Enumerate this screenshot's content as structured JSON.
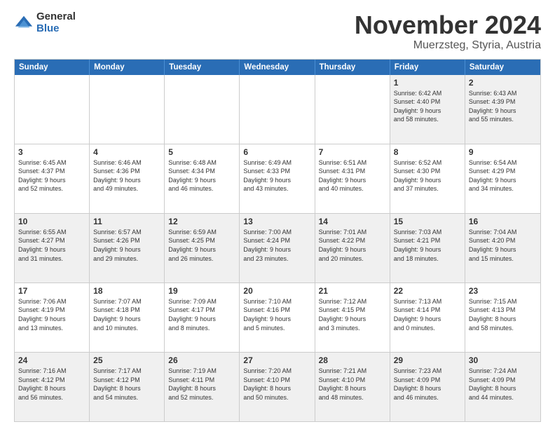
{
  "header": {
    "logo": {
      "general": "General",
      "blue": "Blue"
    },
    "title": "November 2024",
    "location": "Muerzsteg, Styria, Austria"
  },
  "calendar": {
    "days": [
      "Sunday",
      "Monday",
      "Tuesday",
      "Wednesday",
      "Thursday",
      "Friday",
      "Saturday"
    ],
    "weeks": [
      [
        {
          "day": "",
          "content": ""
        },
        {
          "day": "",
          "content": ""
        },
        {
          "day": "",
          "content": ""
        },
        {
          "day": "",
          "content": ""
        },
        {
          "day": "",
          "content": ""
        },
        {
          "day": "1",
          "content": "Sunrise: 6:42 AM\nSunset: 4:40 PM\nDaylight: 9 hours\nand 58 minutes."
        },
        {
          "day": "2",
          "content": "Sunrise: 6:43 AM\nSunset: 4:39 PM\nDaylight: 9 hours\nand 55 minutes."
        }
      ],
      [
        {
          "day": "3",
          "content": "Sunrise: 6:45 AM\nSunset: 4:37 PM\nDaylight: 9 hours\nand 52 minutes."
        },
        {
          "day": "4",
          "content": "Sunrise: 6:46 AM\nSunset: 4:36 PM\nDaylight: 9 hours\nand 49 minutes."
        },
        {
          "day": "5",
          "content": "Sunrise: 6:48 AM\nSunset: 4:34 PM\nDaylight: 9 hours\nand 46 minutes."
        },
        {
          "day": "6",
          "content": "Sunrise: 6:49 AM\nSunset: 4:33 PM\nDaylight: 9 hours\nand 43 minutes."
        },
        {
          "day": "7",
          "content": "Sunrise: 6:51 AM\nSunset: 4:31 PM\nDaylight: 9 hours\nand 40 minutes."
        },
        {
          "day": "8",
          "content": "Sunrise: 6:52 AM\nSunset: 4:30 PM\nDaylight: 9 hours\nand 37 minutes."
        },
        {
          "day": "9",
          "content": "Sunrise: 6:54 AM\nSunset: 4:29 PM\nDaylight: 9 hours\nand 34 minutes."
        }
      ],
      [
        {
          "day": "10",
          "content": "Sunrise: 6:55 AM\nSunset: 4:27 PM\nDaylight: 9 hours\nand 31 minutes."
        },
        {
          "day": "11",
          "content": "Sunrise: 6:57 AM\nSunset: 4:26 PM\nDaylight: 9 hours\nand 29 minutes."
        },
        {
          "day": "12",
          "content": "Sunrise: 6:59 AM\nSunset: 4:25 PM\nDaylight: 9 hours\nand 26 minutes."
        },
        {
          "day": "13",
          "content": "Sunrise: 7:00 AM\nSunset: 4:24 PM\nDaylight: 9 hours\nand 23 minutes."
        },
        {
          "day": "14",
          "content": "Sunrise: 7:01 AM\nSunset: 4:22 PM\nDaylight: 9 hours\nand 20 minutes."
        },
        {
          "day": "15",
          "content": "Sunrise: 7:03 AM\nSunset: 4:21 PM\nDaylight: 9 hours\nand 18 minutes."
        },
        {
          "day": "16",
          "content": "Sunrise: 7:04 AM\nSunset: 4:20 PM\nDaylight: 9 hours\nand 15 minutes."
        }
      ],
      [
        {
          "day": "17",
          "content": "Sunrise: 7:06 AM\nSunset: 4:19 PM\nDaylight: 9 hours\nand 13 minutes."
        },
        {
          "day": "18",
          "content": "Sunrise: 7:07 AM\nSunset: 4:18 PM\nDaylight: 9 hours\nand 10 minutes."
        },
        {
          "day": "19",
          "content": "Sunrise: 7:09 AM\nSunset: 4:17 PM\nDaylight: 9 hours\nand 8 minutes."
        },
        {
          "day": "20",
          "content": "Sunrise: 7:10 AM\nSunset: 4:16 PM\nDaylight: 9 hours\nand 5 minutes."
        },
        {
          "day": "21",
          "content": "Sunrise: 7:12 AM\nSunset: 4:15 PM\nDaylight: 9 hours\nand 3 minutes."
        },
        {
          "day": "22",
          "content": "Sunrise: 7:13 AM\nSunset: 4:14 PM\nDaylight: 9 hours\nand 0 minutes."
        },
        {
          "day": "23",
          "content": "Sunrise: 7:15 AM\nSunset: 4:13 PM\nDaylight: 8 hours\nand 58 minutes."
        }
      ],
      [
        {
          "day": "24",
          "content": "Sunrise: 7:16 AM\nSunset: 4:12 PM\nDaylight: 8 hours\nand 56 minutes."
        },
        {
          "day": "25",
          "content": "Sunrise: 7:17 AM\nSunset: 4:12 PM\nDaylight: 8 hours\nand 54 minutes."
        },
        {
          "day": "26",
          "content": "Sunrise: 7:19 AM\nSunset: 4:11 PM\nDaylight: 8 hours\nand 52 minutes."
        },
        {
          "day": "27",
          "content": "Sunrise: 7:20 AM\nSunset: 4:10 PM\nDaylight: 8 hours\nand 50 minutes."
        },
        {
          "day": "28",
          "content": "Sunrise: 7:21 AM\nSunset: 4:10 PM\nDaylight: 8 hours\nand 48 minutes."
        },
        {
          "day": "29",
          "content": "Sunrise: 7:23 AM\nSunset: 4:09 PM\nDaylight: 8 hours\nand 46 minutes."
        },
        {
          "day": "30",
          "content": "Sunrise: 7:24 AM\nSunset: 4:09 PM\nDaylight: 8 hours\nand 44 minutes."
        }
      ]
    ]
  }
}
